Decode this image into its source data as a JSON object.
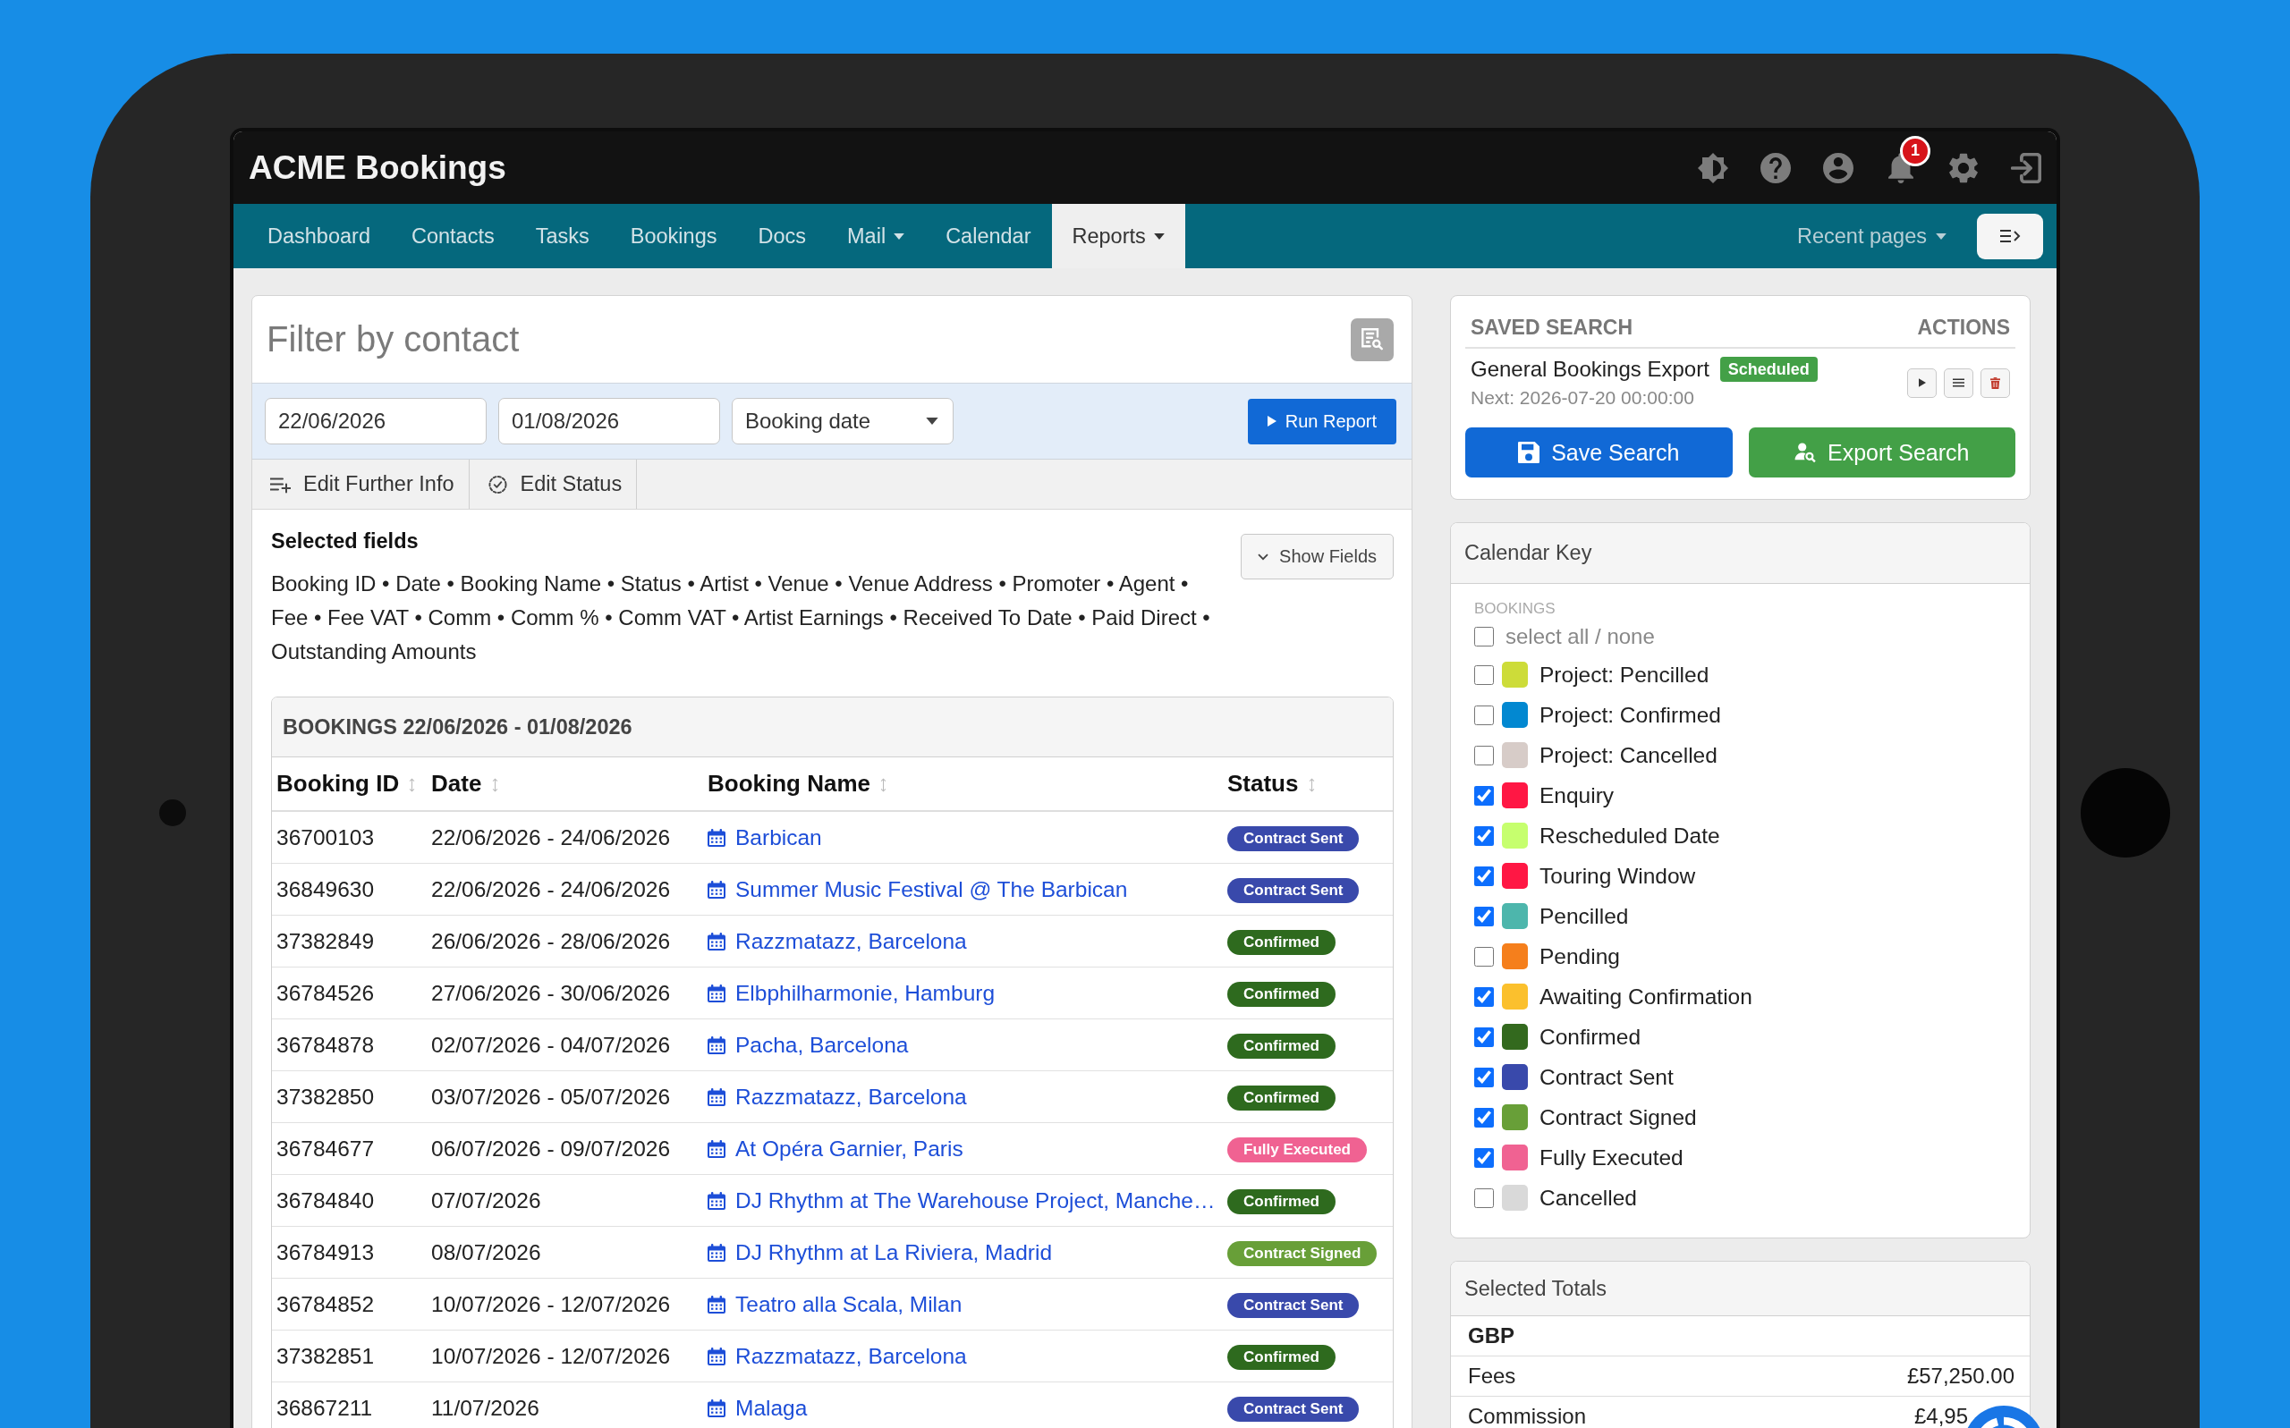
{
  "app": {
    "title": "ACME Bookings",
    "notification_count": "1"
  },
  "nav": {
    "items": [
      {
        "label": "Dashboard",
        "selected": false,
        "dropdown": false
      },
      {
        "label": "Contacts",
        "selected": false,
        "dropdown": false
      },
      {
        "label": "Tasks",
        "selected": false,
        "dropdown": false
      },
      {
        "label": "Bookings",
        "selected": false,
        "dropdown": false
      },
      {
        "label": "Docs",
        "selected": false,
        "dropdown": false
      },
      {
        "label": "Mail",
        "selected": false,
        "dropdown": true
      },
      {
        "label": "Calendar",
        "selected": false,
        "dropdown": false
      },
      {
        "label": "Reports",
        "selected": true,
        "dropdown": true
      }
    ],
    "recent_pages": {
      "label": "Recent pages",
      "dropdown": true
    }
  },
  "filter": {
    "placeholder": "Filter by contact",
    "date_from": "22/06/2026",
    "date_to": "01/08/2026",
    "date_type": "Booking date",
    "run_button": "Run Report"
  },
  "tools": [
    {
      "label": "Edit Further Info",
      "kind": "fields"
    },
    {
      "label": "Edit Status",
      "kind": "status"
    }
  ],
  "selected_fields": {
    "title": "Selected fields",
    "text": "Booking ID • Date • Booking Name • Status • Artist • Venue • Venue Address • Promoter • Agent • Fee • Fee VAT • Comm • Comm % • Comm VAT • Artist Earnings • Received To Date • Paid Direct • Outstanding Amounts",
    "button": "Show Fields"
  },
  "bookings": {
    "title": "BOOKINGS 22/06/2026 - 01/08/2026",
    "columns": [
      {
        "label": "Booking ID",
        "sortable": true
      },
      {
        "label": "Date",
        "sortable": true
      },
      {
        "label": "Booking Name",
        "sortable": true
      },
      {
        "label": "Status",
        "sortable": true
      }
    ],
    "rows": [
      {
        "booking_id": "36700103",
        "date": "22/06/2026 - 24/06/2026",
        "name": "Barbican",
        "status": {
          "label": "Contract Sent",
          "color": "#3949ab"
        }
      },
      {
        "booking_id": "36849630",
        "date": "22/06/2026 - 24/06/2026",
        "name": "Summer Music Festival @ The Barbican",
        "status": {
          "label": "Contract Sent",
          "color": "#3949ab"
        }
      },
      {
        "booking_id": "37382849",
        "date": "26/06/2026 - 28/06/2026",
        "name": "Razzmatazz, Barcelona",
        "status": {
          "label": "Confirmed",
          "color": "#2e6a1e"
        }
      },
      {
        "booking_id": "36784526",
        "date": "27/06/2026 - 30/06/2026",
        "name": "Elbphilharmonie, Hamburg",
        "status": {
          "label": "Confirmed",
          "color": "#2e6a1e"
        }
      },
      {
        "booking_id": "36784878",
        "date": "02/07/2026 - 04/07/2026",
        "name": "Pacha, Barcelona",
        "status": {
          "label": "Confirmed",
          "color": "#2e6a1e"
        }
      },
      {
        "booking_id": "37382850",
        "date": "03/07/2026 - 05/07/2026",
        "name": "Razzmatazz, Barcelona",
        "status": {
          "label": "Confirmed",
          "color": "#2e6a1e"
        }
      },
      {
        "booking_id": "36784677",
        "date": "06/07/2026 - 09/07/2026",
        "name": "At Opéra Garnier, Paris",
        "status": {
          "label": "Fully Executed",
          "color": "#f06292"
        }
      },
      {
        "booking_id": "36784840",
        "date": "07/07/2026",
        "name": "DJ Rhythm at The Warehouse Project, Manche…",
        "status": {
          "label": "Confirmed",
          "color": "#2e6a1e"
        }
      },
      {
        "booking_id": "36784913",
        "date": "08/07/2026",
        "name": "DJ Rhythm at La Riviera, Madrid",
        "status": {
          "label": "Contract Signed",
          "color": "#689f38"
        }
      },
      {
        "booking_id": "36784852",
        "date": "10/07/2026 - 12/07/2026",
        "name": "Teatro alla Scala, Milan",
        "status": {
          "label": "Contract Sent",
          "color": "#3949ab"
        }
      },
      {
        "booking_id": "37382851",
        "date": "10/07/2026 - 12/07/2026",
        "name": "Razzmatazz, Barcelona",
        "status": {
          "label": "Confirmed",
          "color": "#2e6a1e"
        }
      },
      {
        "booking_id": "36867211",
        "date": "11/07/2026",
        "name": "Malaga",
        "status": {
          "label": "Contract Sent",
          "color": "#3949ab"
        }
      }
    ]
  },
  "saved_search": {
    "columns": [
      "SAVED SEARCH",
      "ACTIONS"
    ],
    "items": [
      {
        "name": "General Bookings Export",
        "badge": "Scheduled",
        "next": "Next: 2026-07-20 00:00:00"
      }
    ],
    "save_button": "Save Search",
    "export_button": "Export Search"
  },
  "calendar_key": {
    "title": "Calendar Key",
    "section": "BOOKINGS",
    "select_all": {
      "label": "select all / none",
      "checked": false
    },
    "items": [
      {
        "label": "Project: Pencilled",
        "checked": false,
        "color": "#cddc39"
      },
      {
        "label": "Project: Confirmed",
        "checked": false,
        "color": "#0288d1"
      },
      {
        "label": "Project: Cancelled",
        "checked": false,
        "color": "#d7ccc8"
      },
      {
        "label": "Enquiry",
        "checked": true,
        "color": "#ff1744"
      },
      {
        "label": "Rescheduled Date",
        "checked": true,
        "color": "#c6ff6e"
      },
      {
        "label": "Touring Window",
        "checked": true,
        "color": "#ff1744"
      },
      {
        "label": "Pencilled",
        "checked": true,
        "color": "#4db6ac"
      },
      {
        "label": "Pending",
        "checked": false,
        "color": "#f57f1c"
      },
      {
        "label": "Awaiting Confirmation",
        "checked": true,
        "color": "#fbc02d"
      },
      {
        "label": "Confirmed",
        "checked": true,
        "color": "#33691e"
      },
      {
        "label": "Contract Sent",
        "checked": true,
        "color": "#3949ab"
      },
      {
        "label": "Contract Signed",
        "checked": true,
        "color": "#689f38"
      },
      {
        "label": "Fully Executed",
        "checked": true,
        "color": "#f06292"
      },
      {
        "label": "Cancelled",
        "checked": false,
        "color": "#d9d9d9"
      }
    ]
  },
  "totals": {
    "title": "Selected Totals",
    "currency": "GBP",
    "rows": [
      {
        "label": "Fees",
        "value": "£57,250.00"
      },
      {
        "label": "Commission",
        "value": "£4,95"
      }
    ]
  }
}
